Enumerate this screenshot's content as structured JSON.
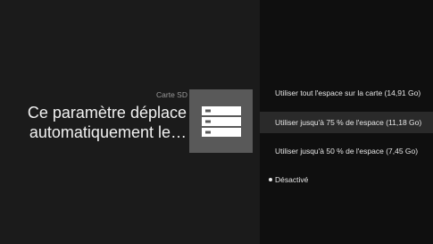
{
  "section_label": "Carte SD",
  "description": "Ce paramètre déplace automatiquement le…",
  "icon": "storage-icon",
  "options": [
    {
      "label": "Utiliser tout l'espace sur la carte (14,91 Go)",
      "selected": false,
      "focused": false
    },
    {
      "label": "Utiliser jusqu'à 75 % de l'espace (11,18 Go)",
      "selected": false,
      "focused": true
    },
    {
      "label": "Utiliser jusqu'à 50 % de l'espace (7,45 Go)",
      "selected": false,
      "focused": false
    },
    {
      "label": "Désactivé",
      "selected": true,
      "focused": false
    }
  ]
}
